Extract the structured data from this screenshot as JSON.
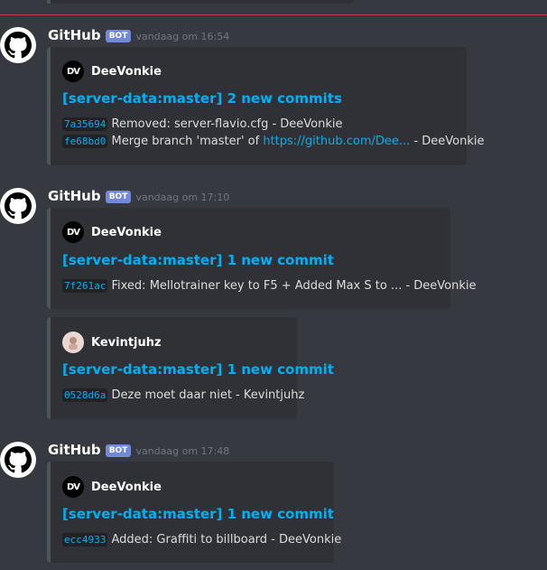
{
  "messages": [
    {
      "username": "GitHub",
      "bot_tag": "BOT",
      "timestamp": "vandaag om 16:54",
      "embeds": [
        {
          "author": "DeeVonkie",
          "author_initials": "DV",
          "title": "[server-data:master] 2 new commits",
          "commits": [
            {
              "hash": "7a35694",
              "text": "Removed: server-flavio.cfg - DeeVonkie"
            },
            {
              "hash": "fe68bd0",
              "text_before": "Merge branch 'master' of ",
              "link": "https://github.com/Dee...",
              "text_after": " - DeeVonkie"
            }
          ]
        }
      ]
    },
    {
      "username": "GitHub",
      "bot_tag": "BOT",
      "timestamp": "vandaag om 17:10",
      "embeds": [
        {
          "author": "DeeVonkie",
          "author_initials": "DV",
          "title": "[server-data:master] 1 new commit",
          "commits": [
            {
              "hash": "7f261ac",
              "text": "Fixed: Mellotrainer key to F5 + Added Max S to ... - DeeVonkie"
            }
          ]
        },
        {
          "author": "Kevintjuhz",
          "title": "[server-data:master] 1 new commit",
          "commits": [
            {
              "hash": "0528d6a",
              "text": "Deze moet daar niet - Kevintjuhz"
            }
          ]
        }
      ]
    },
    {
      "username": "GitHub",
      "bot_tag": "BOT",
      "timestamp": "vandaag om 17:48",
      "embeds": [
        {
          "author": "DeeVonkie",
          "author_initials": "DV",
          "title": "[server-data:master] 1 new commit",
          "commits": [
            {
              "hash": "ecc4933",
              "text": "Added: Graffiti to billboard - DeeVonkie"
            }
          ]
        }
      ]
    }
  ],
  "colors": {
    "background": "#36393f",
    "embed_background": "#2f3136",
    "link": "#00b0f4",
    "bot_tag": "#7289da",
    "new_divider": "#b94047"
  }
}
